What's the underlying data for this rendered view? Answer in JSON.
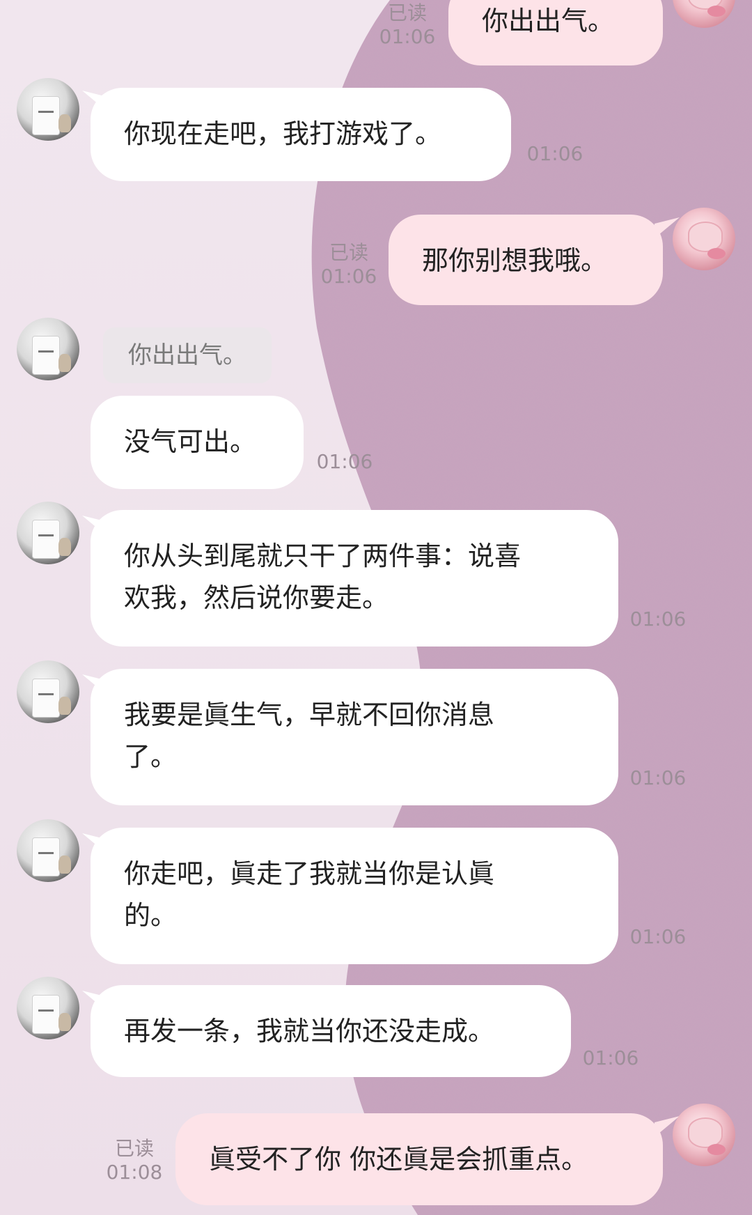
{
  "messages": [
    {
      "id": "m0",
      "side": "me",
      "text": "你出出气。",
      "read": "已读",
      "time": "01:06"
    },
    {
      "id": "m1",
      "side": "them",
      "text": "你现在走吧，我打游戏了。",
      "time": "01:06"
    },
    {
      "id": "m2",
      "side": "me",
      "text": "那你别想我哦。",
      "read": "已读",
      "time": "01:06"
    },
    {
      "id": "m3",
      "side": "them",
      "quote": "你出出气。",
      "text": "没气可出。",
      "time": "01:06"
    },
    {
      "id": "m4",
      "side": "them",
      "text": "你从头到尾就只干了两件事：说喜\n欢我，然后说你要走。",
      "time": "01:06"
    },
    {
      "id": "m5",
      "side": "them",
      "text": "我要是眞生气，早就不回你消息\n了。",
      "time": "01:06"
    },
    {
      "id": "m6",
      "side": "them",
      "text": "你走吧，眞走了我就当你是认眞\n的。",
      "time": "01:06"
    },
    {
      "id": "m7",
      "side": "them",
      "text": "再发一条，我就当你还没走成。",
      "time": "01:06"
    },
    {
      "id": "m8",
      "side": "me",
      "text": "眞受不了你 你还眞是会抓重点。",
      "read": "已读",
      "time": "01:08"
    }
  ],
  "colors": {
    "bubble_them": "#ffffff",
    "bubble_me": "#fde3e8",
    "background_left": "#efe3ec",
    "background_right": "#c8a3bf",
    "meta_text": "#9c8e98"
  }
}
